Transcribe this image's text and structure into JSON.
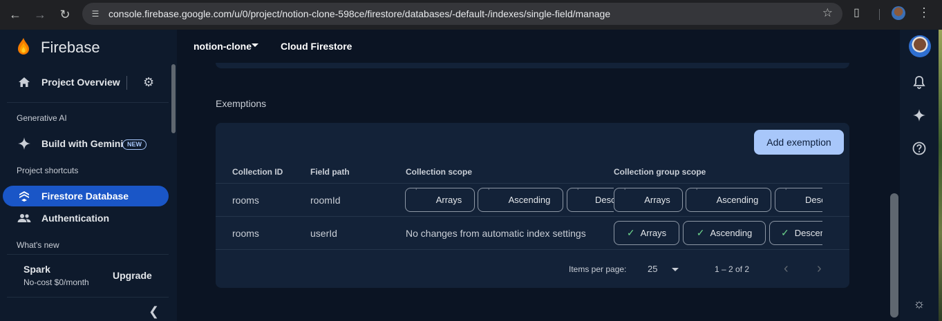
{
  "browser": {
    "url": "console.firebase.google.com/u/0/project/notion-clone-598ce/firestore/databases/-default-/indexes/single-field/manage",
    "icons": [
      "back-icon",
      "forward-icon",
      "reload-icon",
      "site-info-icon",
      "bookmark-star-icon",
      "extensions-icon",
      "profile-avatar",
      "menu-kebab-icon"
    ]
  },
  "sidebar": {
    "brand": "Firebase",
    "overview": "Project Overview",
    "sections": {
      "generative_ai": "Generative AI",
      "shortcuts": "Project shortcuts",
      "whats_new": "What's new"
    },
    "items": {
      "gemini": "Build with Gemini",
      "gemini_badge": "NEW",
      "firestore": "Firestore Database",
      "authentication": "Authentication"
    },
    "plan": {
      "name": "Spark",
      "desc": "No-cost $0/month",
      "upgrade": "Upgrade"
    }
  },
  "topbar": {
    "project": "notion-clone",
    "product": "Cloud Firestore"
  },
  "main": {
    "exemptions_title": "Exemptions",
    "add_button": "Add exemption",
    "headers": {
      "collection_id": "Collection ID",
      "field_path": "Field path",
      "collection_scope": "Collection scope",
      "collection_group_scope": "Collection group scope"
    },
    "rows": [
      {
        "collection_id": "rooms",
        "field_path": "roomId",
        "collection_scope_chips": [
          "Arrays",
          "Ascending",
          "Descending"
        ],
        "group_scope_chips": [
          "Arrays",
          "Ascending",
          "Descending"
        ]
      },
      {
        "collection_id": "rooms",
        "field_path": "userId",
        "collection_scope_text": "No changes from automatic index settings",
        "group_scope_chips": [
          "Arrays",
          "Ascending",
          "Descending"
        ]
      }
    ],
    "pager": {
      "label": "Items per page:",
      "size": "25",
      "range": "1 – 2 of 2"
    }
  },
  "colors": {
    "accent": "#1a56c7",
    "button": "#a8c7fa",
    "check": "#6dd58c",
    "background": "#0b1423"
  }
}
